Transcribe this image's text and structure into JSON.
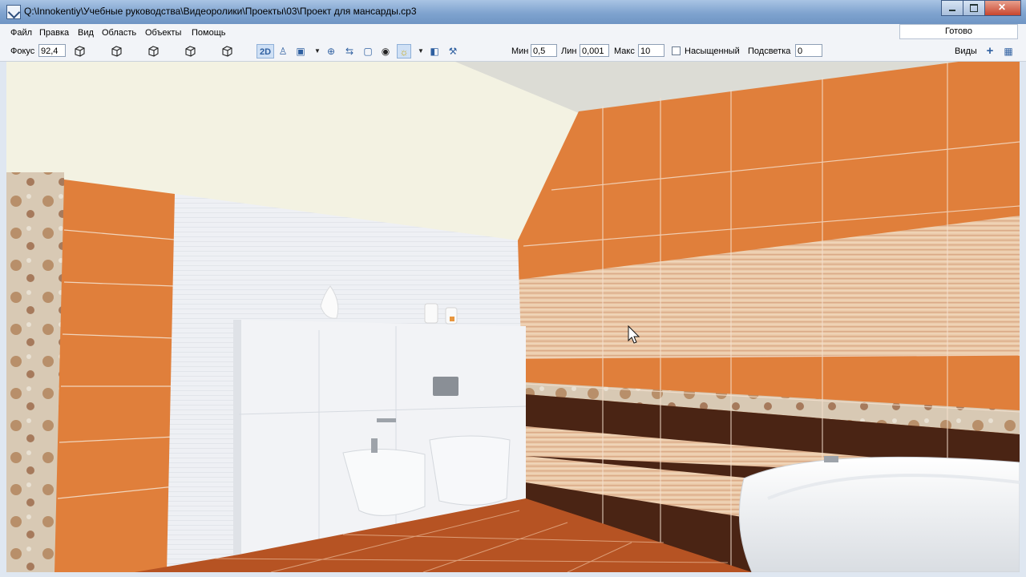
{
  "window": {
    "title": "Q:\\Innokentiy\\Учебные руководства\\Видеоролики\\Проекты\\03\\Проект для мансарды.cp3"
  },
  "menu": [
    "Файл",
    "Правка",
    "Вид",
    "Область",
    "Объекты",
    "Помощь"
  ],
  "status_text": "Готово",
  "toolbar": {
    "focus_label": "Фокус",
    "focus_value": "92,4",
    "mode_2d": "2D",
    "min_label": "Мин",
    "min_value": "0,5",
    "lin_label": "Лин",
    "lin_value": "0,001",
    "max_label": "Макс",
    "max_value": "10",
    "saturated_label": "Насыщенный",
    "saturated_checked": false,
    "backlight_label": "Подсветка",
    "backlight_value": "0",
    "views_label": "Виды"
  },
  "icons": [
    "app-icon",
    "minimize-icon",
    "maximize-icon",
    "close-icon",
    "cube-view-icon",
    "person-icon",
    "camera-icon",
    "target-icon",
    "swap-icon",
    "frame-icon",
    "eye-icon",
    "sun-icon",
    "book-icon",
    "tools-icon",
    "plus-icon",
    "grid-icon",
    "mouse-cursor-icon"
  ],
  "colors": {
    "orange_tile": "#e07f3b",
    "dark_brown_tile": "#4a2414",
    "beige_stripe": "#e9c3a3",
    "white_tile": "#eef0f4",
    "floor": "#b65323",
    "ceiling": "#f2f1df"
  }
}
